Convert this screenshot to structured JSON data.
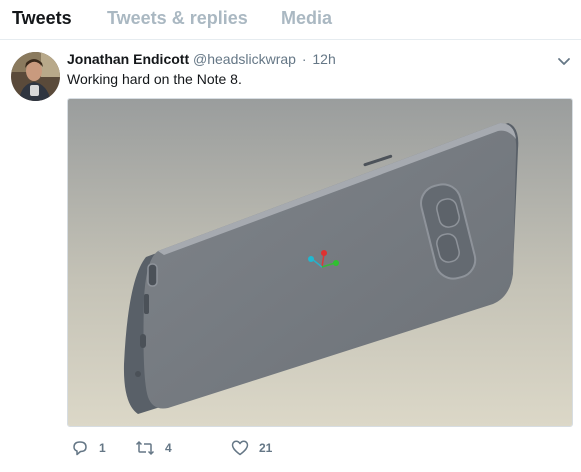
{
  "tabs": [
    {
      "label": "Tweets",
      "active": true
    },
    {
      "label": "Tweets & replies",
      "active": false
    },
    {
      "label": "Media",
      "active": false
    }
  ],
  "tweet": {
    "name": "Jonathan Endicott",
    "handle": "@headslickwrap",
    "separator": "·",
    "time": "12h",
    "text": "Working hard on the Note 8.",
    "actions": {
      "reply_count": "1",
      "retweet_count": "4",
      "like_count": "21"
    }
  },
  "icons": {
    "caret": "chevron-down-icon",
    "reply": "reply-icon",
    "retweet": "retweet-icon",
    "like": "heart-icon"
  },
  "colors": {
    "text_primary": "#14171a",
    "text_secondary": "#657786",
    "tab_inactive": "#aab8c2",
    "divider": "#e6ecf0"
  }
}
